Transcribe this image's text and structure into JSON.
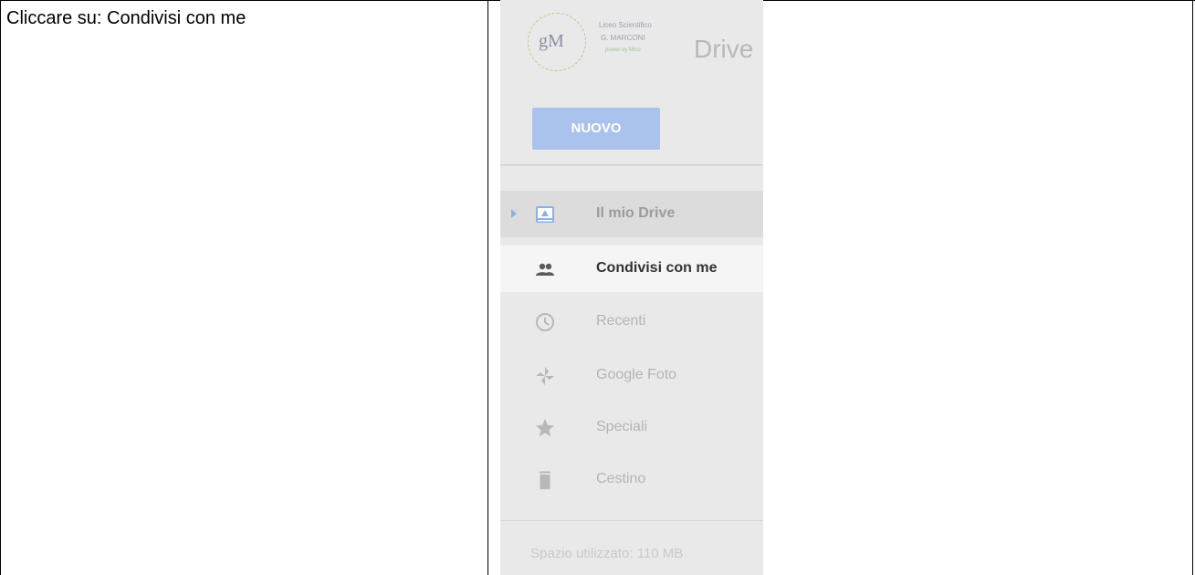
{
  "instruction": "Cliccare su: Condivisi con me",
  "logo": {
    "monogram": "gM",
    "line1": "Liceo Scientifico",
    "line2": "G. MARCONI",
    "line3": "power by Miso"
  },
  "app_name": "Drive",
  "new_button": "NUOVO",
  "nav": [
    {
      "label": "Il mio Drive",
      "icon": "my-drive-icon"
    },
    {
      "label": "Condivisi con me",
      "icon": "people-icon"
    },
    {
      "label": "Recenti",
      "icon": "clock-icon"
    },
    {
      "label": "Google Foto",
      "icon": "pinwheel-icon"
    },
    {
      "label": "Speciali",
      "icon": "star-icon"
    },
    {
      "label": "Cestino",
      "icon": "trash-icon"
    }
  ],
  "storage_text": "Spazio utilizzato: 110 MB",
  "colors": {
    "sidebar_bg": "#e9e9e9",
    "selected_bg": "#f5f5f5",
    "new_button": "#a9c3ec",
    "drive_icon": "#8ab2e4"
  }
}
